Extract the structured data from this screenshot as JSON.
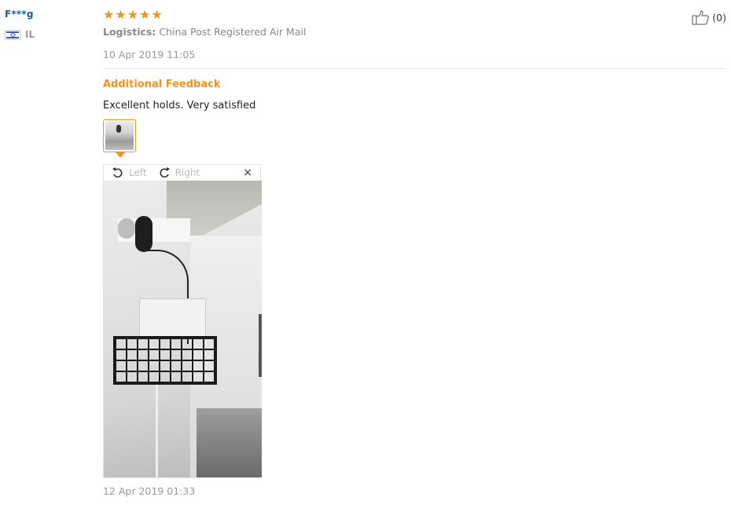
{
  "user": {
    "name": "F***g",
    "country_code": "IL"
  },
  "review": {
    "rating": 5,
    "stars": [
      "★",
      "★",
      "★",
      "★",
      "★"
    ],
    "logistics_label": "Logistics:",
    "logistics_value": "China Post Registered Air Mail",
    "date": "10 Apr 2019 11:05",
    "additional_title": "Additional Feedback",
    "additional_text": "Excellent holds. Very satisfied",
    "viewer": {
      "rotate_left_label": "Left",
      "rotate_right_label": "Right",
      "close_symbol": "×"
    },
    "additional_date": "12 Apr 2019 01:33"
  },
  "helpful": {
    "count": "(0)"
  },
  "colors": {
    "accent": "#f5931c",
    "user_link": "#1b5fa0"
  },
  "icons": [
    "flag-icon",
    "star-icon",
    "thumb-up-icon",
    "rotate-left-icon",
    "rotate-right-icon",
    "close-icon"
  ]
}
